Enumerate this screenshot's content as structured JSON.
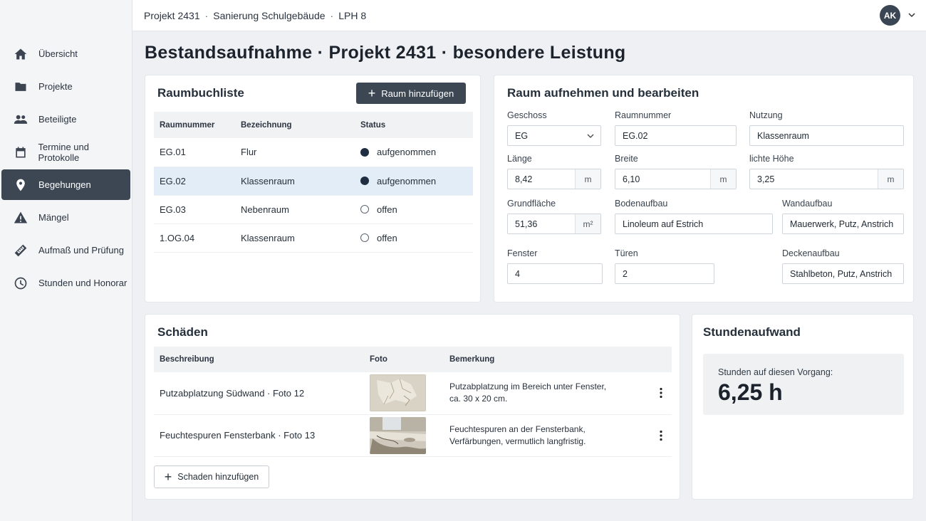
{
  "breadcrumb": [
    "Projekt 2431",
    "Sanierung Schulgebäude",
    "LPH 8"
  ],
  "user": {
    "initials": "AK"
  },
  "page_title": "Bestandsaufnahme · Projekt 2431 · besondere Leistung",
  "sidebar": {
    "items": [
      {
        "label": "Übersicht",
        "icon": "home-icon"
      },
      {
        "label": "Projekte",
        "icon": "folder-icon"
      },
      {
        "label": "Beteiligte",
        "icon": "people-icon"
      },
      {
        "label": "Termine und Protokolle",
        "icon": "calendar-icon"
      },
      {
        "label": "Begehungen",
        "icon": "location-pin-icon",
        "active": true
      },
      {
        "label": "Mängel",
        "icon": "warning-icon"
      },
      {
        "label": "Aufmaß und Prüfung",
        "icon": "ruler-icon"
      },
      {
        "label": "Stunden und Honorar",
        "icon": "clock-icon"
      }
    ]
  },
  "raumbuch": {
    "title": "Raumbuchliste",
    "add_button": "Raum hinzufügen",
    "columns": [
      "Raumnummer",
      "Bezeichnung",
      "Status"
    ],
    "rows": [
      {
        "nr": "EG.01",
        "name": "Flur",
        "status": "aufgenommen",
        "done": true
      },
      {
        "nr": "EG.02",
        "name": "Klassenraum",
        "status": "aufgenommen",
        "done": true,
        "selected": true
      },
      {
        "nr": "EG.03",
        "name": "Nebenraum",
        "status": "offen",
        "done": false
      },
      {
        "nr": "1.OG.04",
        "name": "Klassenraum",
        "status": "offen",
        "done": false
      }
    ]
  },
  "raum": {
    "title": "Raum aufnehmen und bearbeiten",
    "geschoss": {
      "label": "Geschoss",
      "value": "EG"
    },
    "raumnummer": {
      "label": "Raumnummer",
      "value": "EG.02"
    },
    "nutzung": {
      "label": "Nutzung",
      "value": "Klassenraum"
    },
    "laenge": {
      "label": "Länge",
      "value": "8,42",
      "unit": "m"
    },
    "breite": {
      "label": "Breite",
      "value": "6,10",
      "unit": "m"
    },
    "hoehe": {
      "label": "lichte Höhe",
      "value": "3,25",
      "unit": "m"
    },
    "grundflaeche": {
      "label": "Grundfläche",
      "value": "51,36",
      "unit": "m²"
    },
    "bodenaufbau": {
      "label": "Bodenaufbau",
      "value": "Linoleum auf Estrich"
    },
    "wandaufbau": {
      "label": "Wandaufbau",
      "value": "Mauerwerk, Putz, Anstrich"
    },
    "fenster": {
      "label": "Fenster",
      "value": "4"
    },
    "tueren": {
      "label": "Türen",
      "value": "2"
    },
    "deckenaufbau": {
      "label": "Deckenaufbau",
      "value": "Stahlbeton, Putz, Anstrich"
    }
  },
  "schaeden": {
    "title": "Schäden",
    "columns": [
      "Beschreibung",
      "Foto",
      "Bemerkung"
    ],
    "rows": [
      {
        "desc": "Putzabplatzung Südwand · Foto 12",
        "remark_1": "Putzabplatzung im Bereich unter Fenster,",
        "remark_2": "ca. 30 x 20 cm."
      },
      {
        "desc": "Feuchtespuren Fensterbank · Foto 13",
        "remark_1": "Feuchtespuren an der Fensterbank,",
        "remark_2": "Verfärbungen, vermutlich langfristig."
      }
    ],
    "add_button": "Schaden hinzufügen"
  },
  "stunden": {
    "title": "Stundenaufwand",
    "label": "Stunden auf diesen Vorgang:",
    "value": "6,25 h"
  }
}
